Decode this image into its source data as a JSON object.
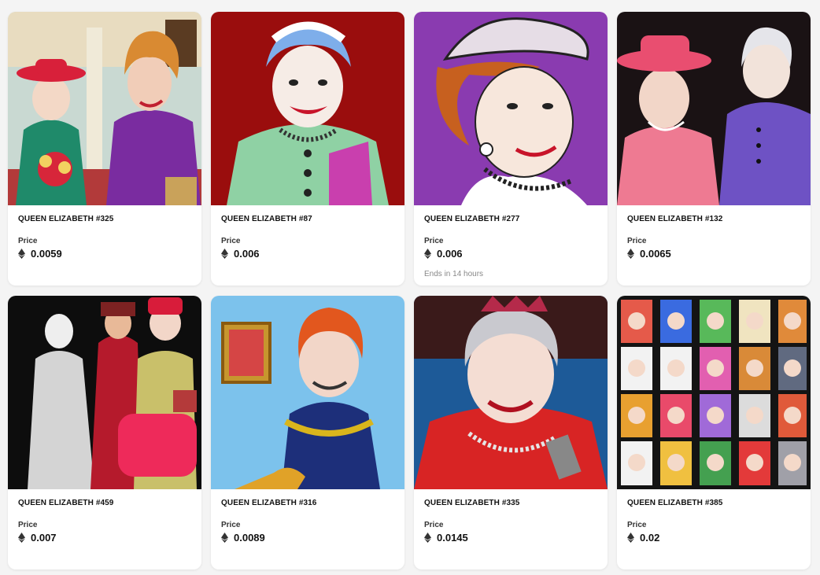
{
  "price_label": "Price",
  "items": [
    {
      "title": "QUEEN ELIZABETH #325",
      "price": "0.0059",
      "ends": ""
    },
    {
      "title": "QUEEN ELIZABETH #87",
      "price": "0.006",
      "ends": ""
    },
    {
      "title": "QUEEN ELIZABETH #277",
      "price": "0.006",
      "ends": "Ends in 14 hours"
    },
    {
      "title": "QUEEN ELIZABETH #132",
      "price": "0.0065",
      "ends": ""
    },
    {
      "title": "QUEEN ELIZABETH #459",
      "price": "0.007",
      "ends": ""
    },
    {
      "title": "QUEEN ELIZABETH #316",
      "price": "0.0089",
      "ends": ""
    },
    {
      "title": "QUEEN ELIZABETH #335",
      "price": "0.0145",
      "ends": ""
    },
    {
      "title": "QUEEN ELIZABETH #385",
      "price": "0.02",
      "ends": ""
    }
  ]
}
